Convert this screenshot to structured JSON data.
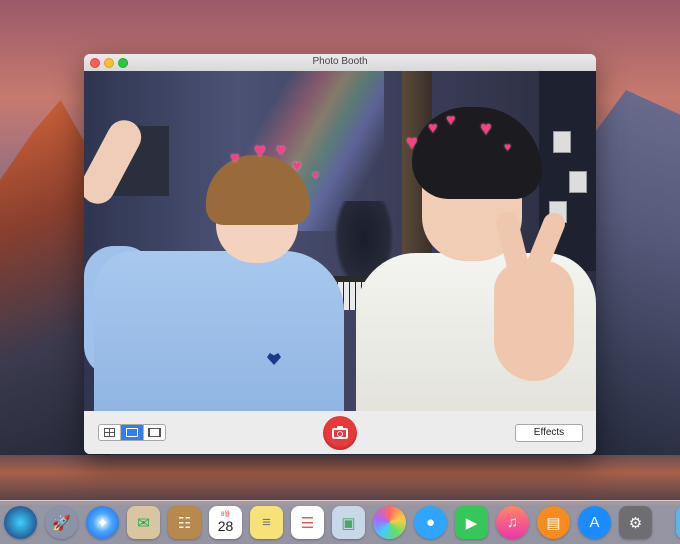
{
  "window": {
    "title": "Photo Booth"
  },
  "toolbar": {
    "view_modes": [
      "grid",
      "single",
      "filmstrip"
    ],
    "active_view": "single",
    "effects_label": "Effects"
  },
  "dock": {
    "items": [
      {
        "name": "siri",
        "glyph": "◉"
      },
      {
        "name": "launchpad",
        "glyph": "🚀"
      },
      {
        "name": "safari",
        "glyph": "✦"
      },
      {
        "name": "mail",
        "glyph": "✉"
      },
      {
        "name": "contacts",
        "glyph": "☷"
      },
      {
        "name": "calendar",
        "day": "28",
        "month": "8월"
      },
      {
        "name": "notes",
        "glyph": "≡"
      },
      {
        "name": "reminders",
        "glyph": "☰"
      },
      {
        "name": "preview",
        "glyph": "▣"
      },
      {
        "name": "photos",
        "glyph": "✿"
      },
      {
        "name": "messages",
        "glyph": "●"
      },
      {
        "name": "facetime",
        "glyph": "▶"
      },
      {
        "name": "itunes",
        "glyph": "♫"
      },
      {
        "name": "ibooks",
        "glyph": "▤"
      },
      {
        "name": "app-store",
        "glyph": "A"
      },
      {
        "name": "system-preferences",
        "glyph": "⚙"
      },
      {
        "name": "downloads-folder",
        "glyph": "▭"
      }
    ]
  },
  "colors": {
    "shutter": "#e83a3a",
    "active_segment": "#2f7ff0",
    "hearts": "#ff3d86"
  }
}
